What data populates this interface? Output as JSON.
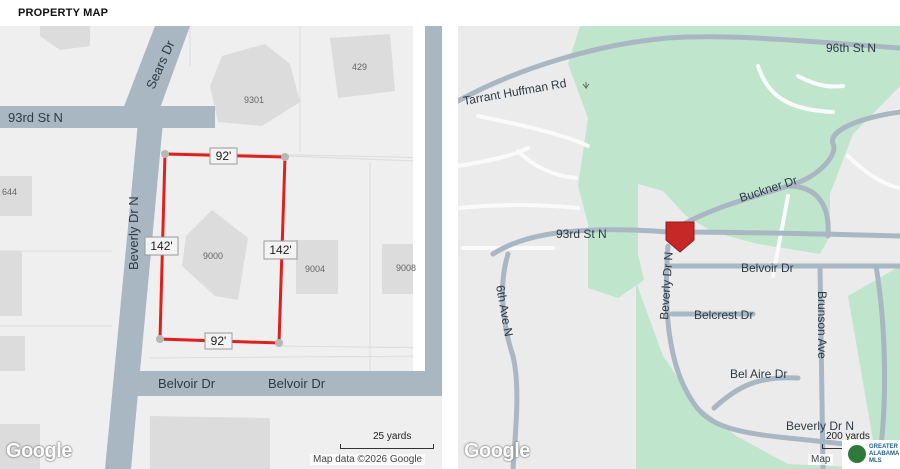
{
  "header": {
    "title": "PROPERTY MAP"
  },
  "parcel_map": {
    "streets": [
      "93rd St N",
      "Sears Dr",
      "Beverly Dr N",
      "Belvoir Dr",
      "Belvoir Dr"
    ],
    "parcels": [
      "429",
      "9301",
      "644",
      "9000",
      "9004",
      "9008"
    ],
    "dimensions": {
      "top": "92'",
      "bottom": "92'",
      "left": "142'",
      "right": "142'"
    },
    "google_logo": "Google",
    "attribution": "Map data ©2026 Google",
    "scale": "25 yards",
    "boundary_color": "#e0201c"
  },
  "area_map": {
    "roads": [
      "96th St N",
      "Tarrant Huffman Rd",
      "Buckner Dr",
      "93rd St N",
      "Belvoir Dr",
      "6th Ave N",
      "Beverly Dr N",
      "Belcrest Dr",
      "Brunson Ave",
      "Bel Aire Dr",
      "Beverly Dr N"
    ],
    "google_logo": "Google",
    "attribution": "Map",
    "scale": "200 yards",
    "marker_color": "#c62828"
  },
  "badge": {
    "text": "GREATER ALABAMA MLS"
  }
}
